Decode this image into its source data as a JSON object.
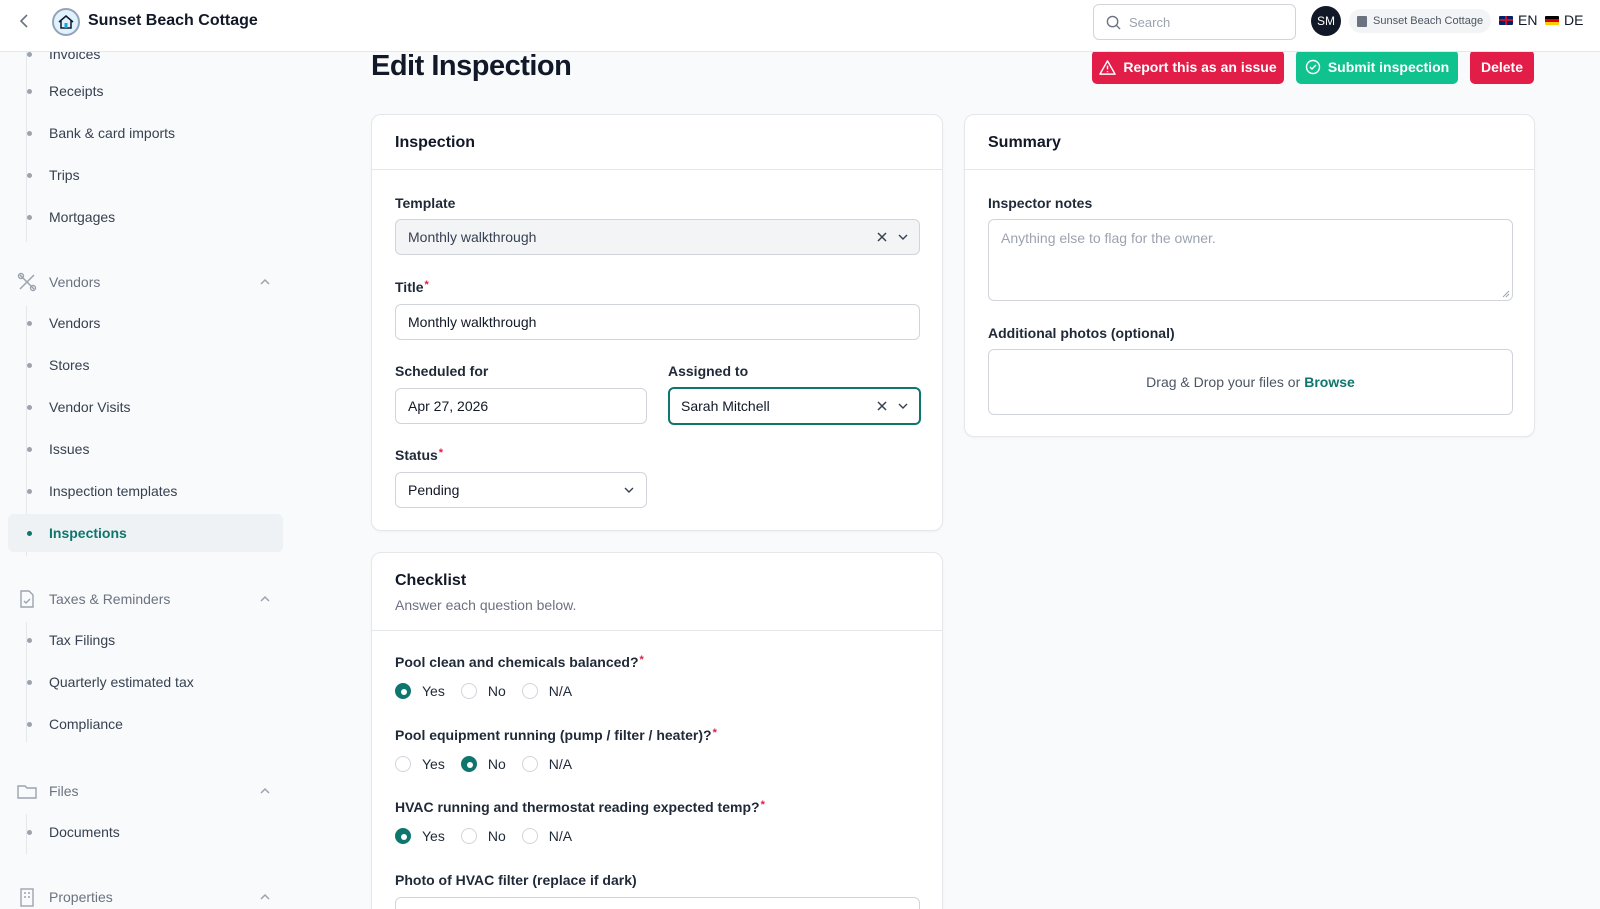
{
  "app": {
    "title": "Sunset Beach Cottage"
  },
  "search": {
    "placeholder": "Search"
  },
  "user": {
    "initials": "SM"
  },
  "property_switcher": {
    "label": "Sunset Beach Cottage"
  },
  "languages": [
    {
      "code": "EN",
      "flag": "uk-flag-icon"
    },
    {
      "code": "DE",
      "flag": "germany-flag-icon"
    }
  ],
  "sidebar": {
    "partial_top": "Invoices",
    "finance_items": [
      "Receipts",
      "Bank & card imports",
      "Trips",
      "Mortgages"
    ],
    "vendors": {
      "label": "Vendors",
      "icon": "tools-icon",
      "items": [
        "Vendors",
        "Stores",
        "Vendor Visits",
        "Issues",
        "Inspection templates",
        "Inspections"
      ]
    },
    "taxes": {
      "label": "Taxes & Reminders",
      "icon": "document-check-icon",
      "items": [
        "Tax Filings",
        "Quarterly estimated tax",
        "Compliance"
      ]
    },
    "files": {
      "label": "Files",
      "icon": "folder-icon",
      "items": [
        "Documents"
      ]
    },
    "properties": {
      "label": "Properties",
      "icon": "building-icon"
    },
    "active_item": "Inspections"
  },
  "page": {
    "title": "Edit Inspection",
    "actions": {
      "report": "Report this as an issue",
      "submit": "Submit inspection",
      "delete": "Delete"
    }
  },
  "inspection_card": {
    "title": "Inspection",
    "template": {
      "label": "Template",
      "value": "Monthly walkthrough"
    },
    "title_field": {
      "label": "Title",
      "value": "Monthly walkthrough",
      "required": "*"
    },
    "scheduled": {
      "label": "Scheduled for",
      "value": "Apr 27, 2026"
    },
    "assigned": {
      "label": "Assigned to",
      "value": "Sarah Mitchell"
    },
    "status": {
      "label": "Status",
      "value": "Pending",
      "required": "*"
    }
  },
  "summary_card": {
    "title": "Summary",
    "notes": {
      "label": "Inspector notes",
      "placeholder": "Anything else to flag for the owner."
    },
    "photos": {
      "label": "Additional photos (optional)",
      "drop_text": "Drag & Drop your files or",
      "browse": "Browse"
    }
  },
  "checklist_card": {
    "title": "Checklist",
    "subtitle": "Answer each question below.",
    "options": [
      "Yes",
      "No",
      "N/A"
    ],
    "questions": [
      {
        "text": "Pool clean and chemicals balanced?",
        "required": "*",
        "selected": "Yes"
      },
      {
        "text": "Pool equipment running (pump / filter / heater)?",
        "required": "*",
        "selected": "No"
      },
      {
        "text": "HVAC running and thermostat reading expected temp?",
        "required": "*",
        "selected": "Yes"
      },
      {
        "text": "Photo of HVAC filter (replace if dark)"
      }
    ]
  },
  "colors": {
    "accent": "#0f766e",
    "danger": "#e11d48",
    "success": "#10c28e"
  }
}
